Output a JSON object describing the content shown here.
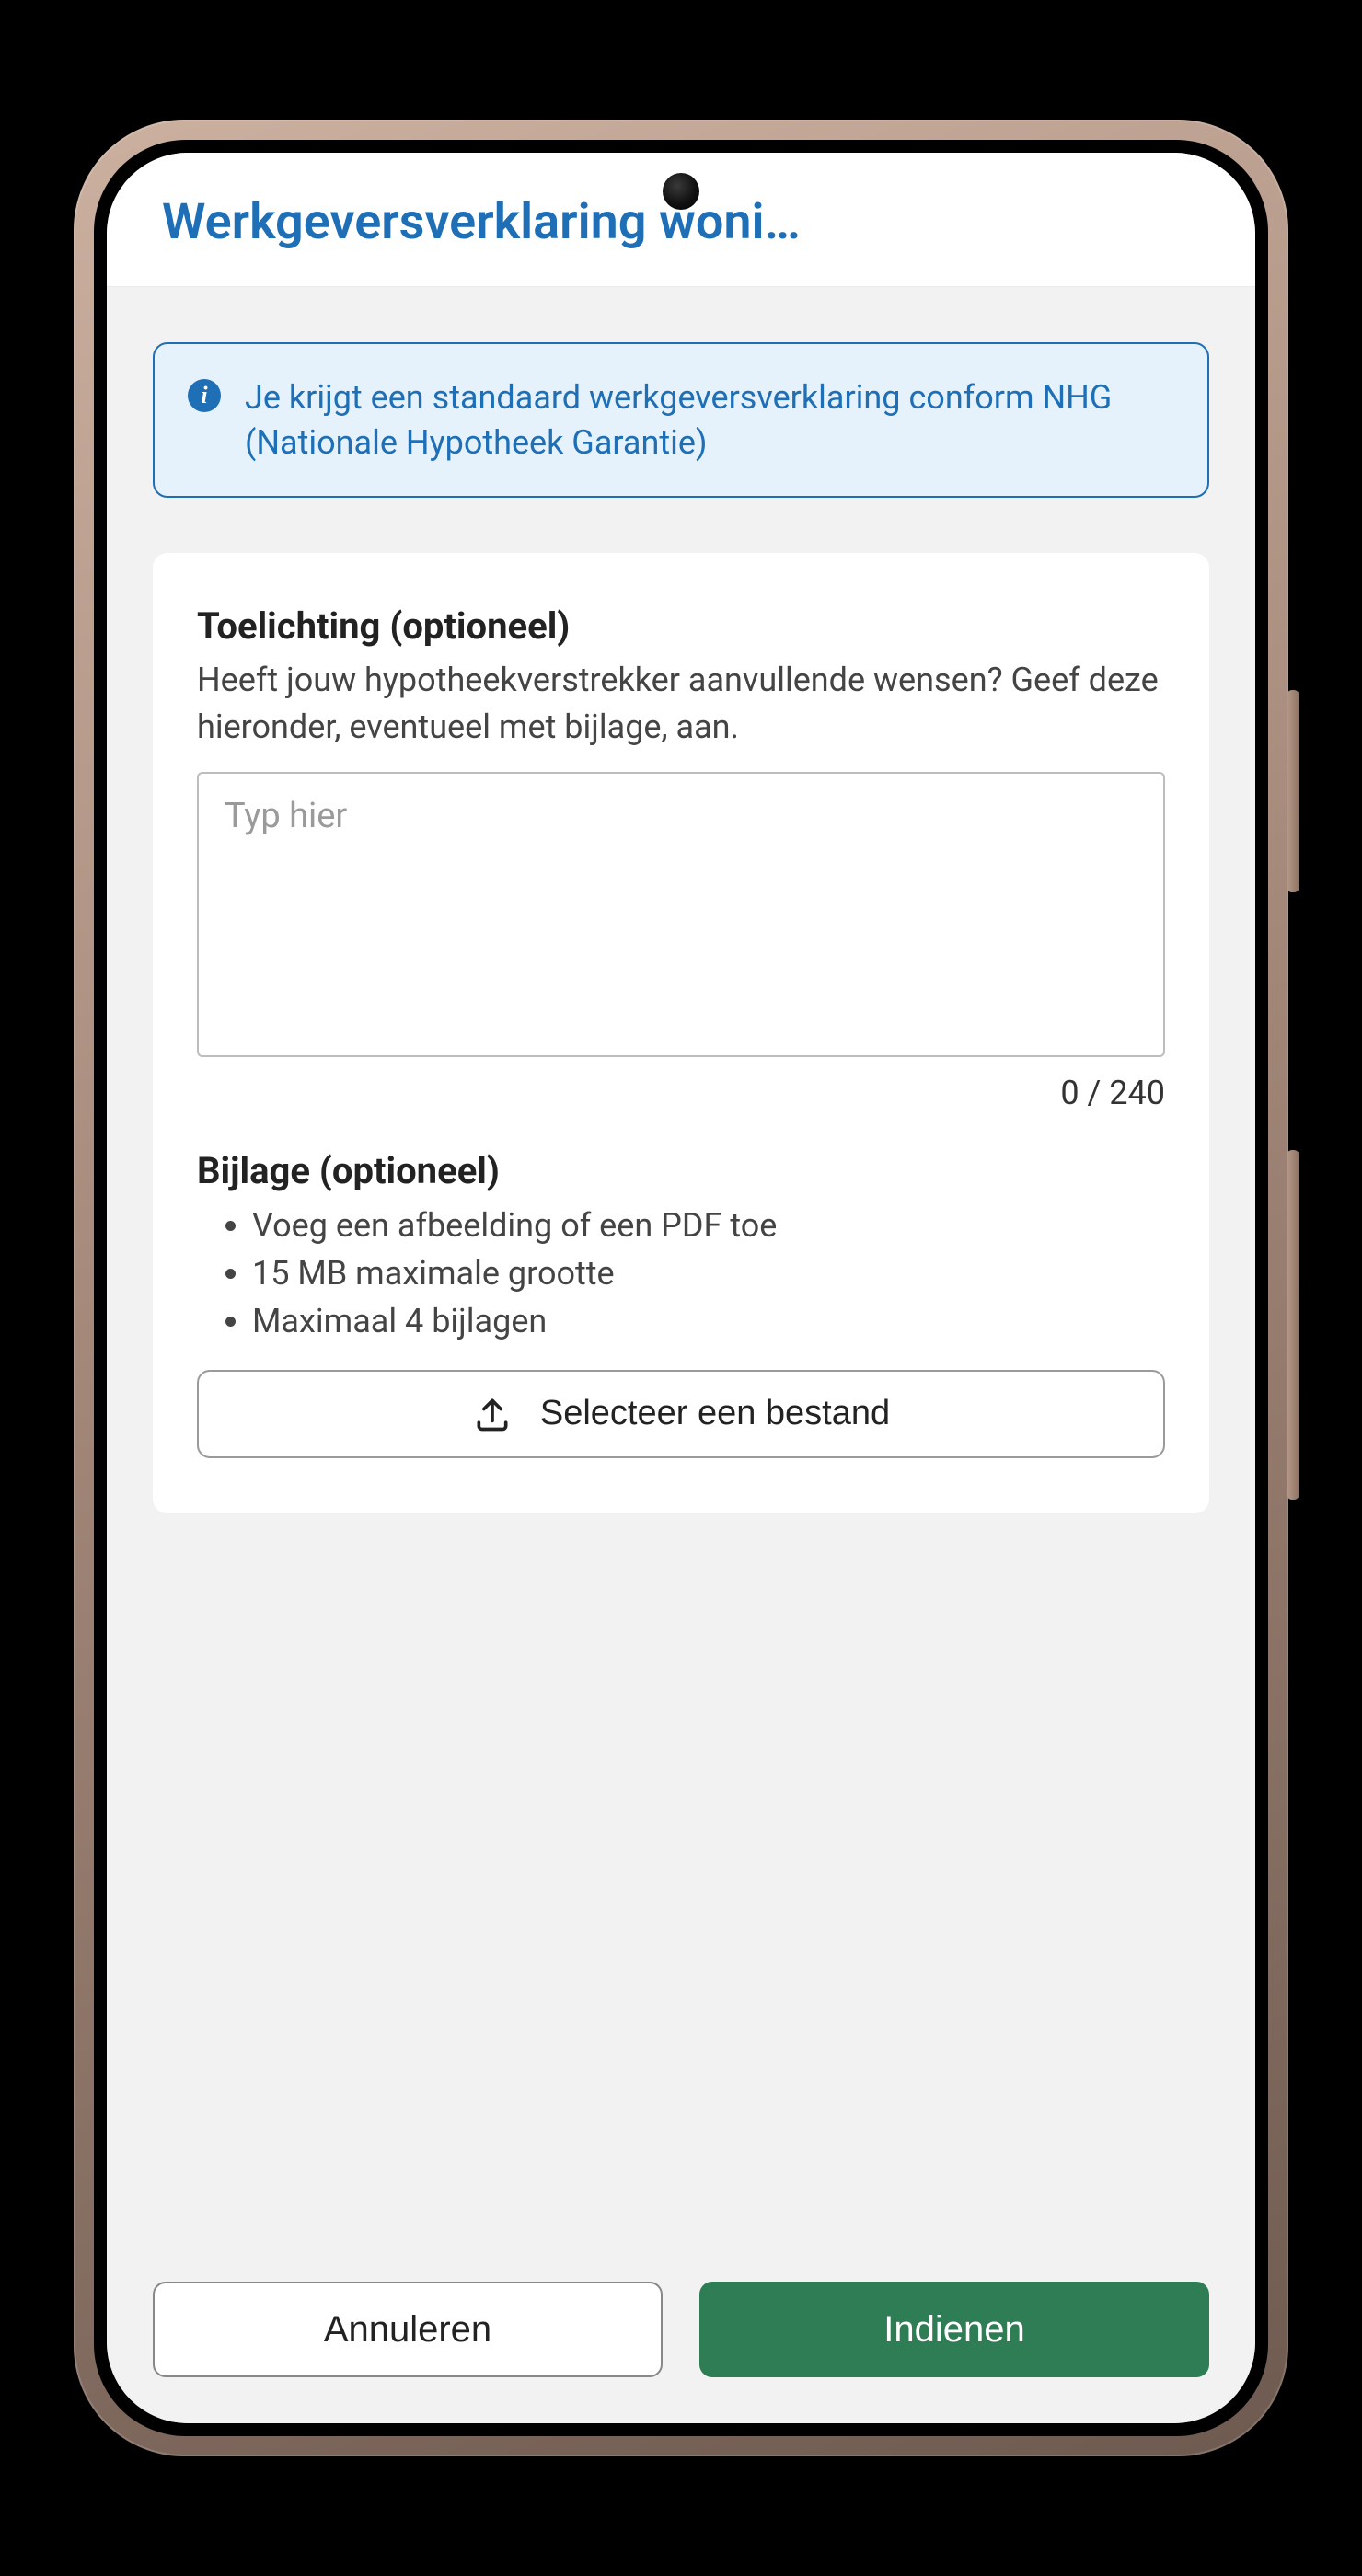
{
  "header": {
    "title": "Werkgeversverklaring woni…"
  },
  "info": {
    "text": "Je krijgt een standaard werkgeversverklaring conform NHG (Nationale Hypotheek Garantie)"
  },
  "explanation": {
    "title": "Toelichting (optioneel)",
    "description": "Heeft jouw hypotheekverstrekker aanvullende wensen? Geef deze hieronder, eventueel met bijlage, aan.",
    "placeholder": "Typ hier",
    "value": "",
    "charCounter": "0 / 240"
  },
  "attachment": {
    "title": "Bijlage (optioneel)",
    "rules": [
      "Voeg een afbeelding of een PDF toe",
      "15 MB maximale grootte",
      "Maximaal 4 bijlagen"
    ],
    "buttonLabel": "Selecteer een bestand"
  },
  "footer": {
    "cancel": "Annuleren",
    "submit": "Indienen"
  }
}
